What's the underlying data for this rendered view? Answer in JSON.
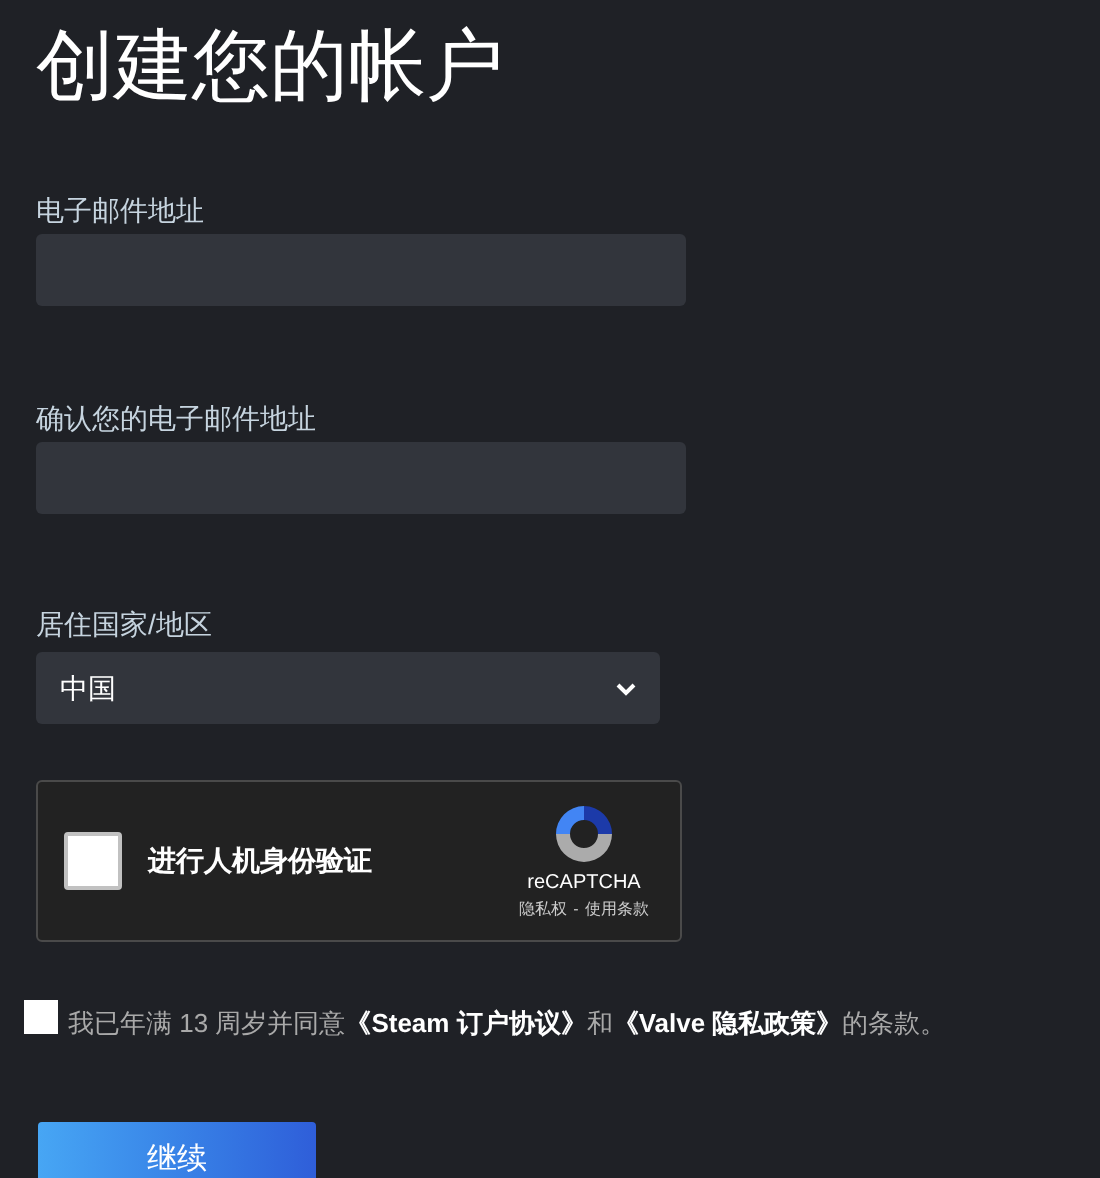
{
  "title": "创建您的帐户",
  "fields": [
    {
      "kind": "text",
      "label": "电子邮件地址"
    },
    {
      "kind": "text",
      "label": "确认您的电子邮件地址"
    },
    {
      "kind": "select",
      "label": "居住国家/地区",
      "value": "中国"
    }
  ],
  "captcha": {
    "checked": false,
    "label": "进行人机身份验证",
    "brand": "reCAPTCHA",
    "privacy": "隐私权",
    "separator": "-",
    "terms": "使用条款"
  },
  "agreement": {
    "checked": false,
    "parts": [
      {
        "kind": "text",
        "text": "我已年满 13 周岁并同意"
      },
      {
        "kind": "link",
        "text": "《Steam 订户协议》"
      },
      {
        "kind": "text",
        "text": "和"
      },
      {
        "kind": "link",
        "text": "《Valve 隐私政策》"
      },
      {
        "kind": "text",
        "text": "的条款。"
      }
    ]
  },
  "continue_button": "继续"
}
